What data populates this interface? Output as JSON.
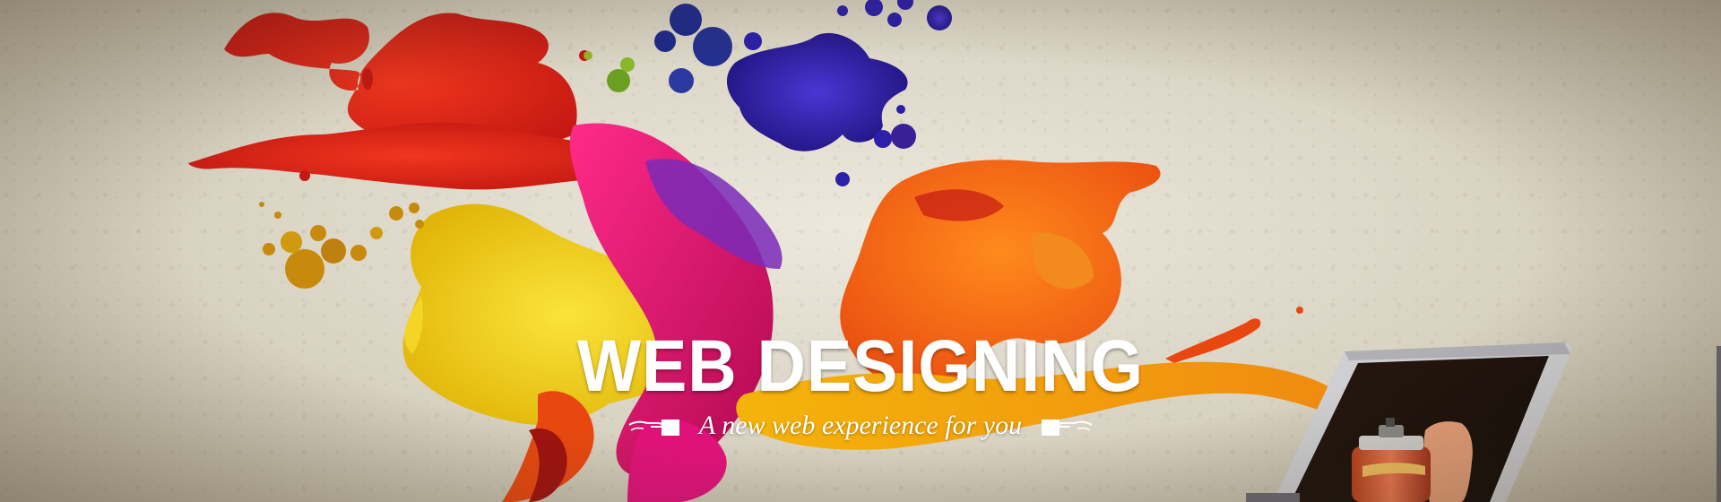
{
  "banner": {
    "headline": "WEB DESIGNING",
    "tagline": "A new web experience for you",
    "icons": {
      "left": "pointing-hand-right-icon",
      "right": "pointing-hand-left-icon",
      "laptop": "laptop-icon",
      "spray": "spray-can-icon"
    },
    "colors": {
      "wall": "#d9d3c3",
      "red": "#e0261c",
      "orange": "#f06a12",
      "yellow": "#f2c90c",
      "magenta": "#e0127a",
      "blue": "#2c1fa8",
      "text": "#ffffff"
    }
  }
}
